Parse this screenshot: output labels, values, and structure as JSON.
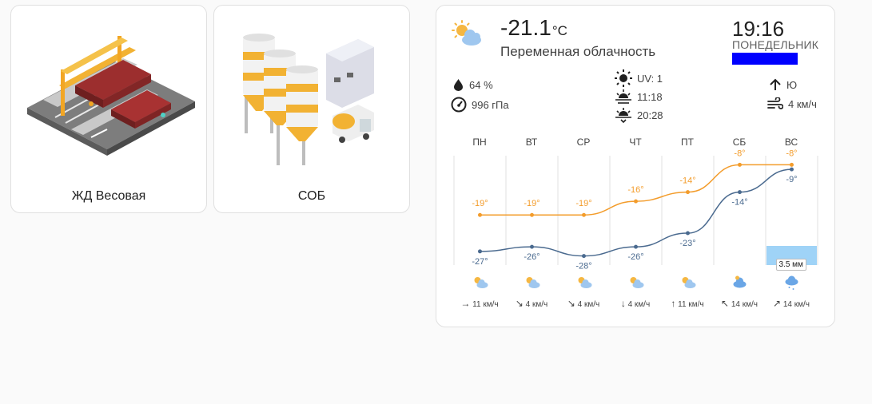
{
  "tiles": [
    {
      "label": "ЖД Весовая",
      "icon": "railway-scale-icon"
    },
    {
      "label": "СОБ",
      "icon": "concrete-plant-icon"
    }
  ],
  "weather": {
    "temperature": "-21.1",
    "unit": "°C",
    "condition": "Переменная облачность",
    "time": "19:16",
    "weekday": "ПОНЕДЕЛЬНИК",
    "humidity": "64 %",
    "pressure": "996 гПа",
    "uv": "UV: 1",
    "sunrise": "11:18",
    "sunset": "20:28",
    "wind_direction": "Ю",
    "wind_speed": "4 км/ч"
  },
  "forecast": {
    "days": [
      "ПН",
      "ВТ",
      "СР",
      "ЧТ",
      "ПТ",
      "СБ",
      "ВС"
    ],
    "wind": [
      {
        "arrow": "→",
        "speed": "11 км/ч"
      },
      {
        "arrow": "↘",
        "speed": "4 км/ч"
      },
      {
        "arrow": "↘",
        "speed": "4 км/ч"
      },
      {
        "arrow": "↓",
        "speed": "4 км/ч"
      },
      {
        "arrow": "↑",
        "speed": "11 км/ч"
      },
      {
        "arrow": "↖",
        "speed": "14 км/ч"
      },
      {
        "arrow": "↗",
        "speed": "14 км/ч"
      }
    ],
    "icons": [
      "partly-cloudy-icon",
      "partly-cloudy-icon",
      "partly-cloudy-icon",
      "partly-cloudy-icon",
      "partly-cloudy-icon",
      "cloudy-snow-icon",
      "snow-icon"
    ]
  },
  "chart_data": {
    "type": "line",
    "categories": [
      "ПН",
      "ВТ",
      "СР",
      "ЧТ",
      "ПТ",
      "СБ",
      "ВС"
    ],
    "series": [
      {
        "values": [
          -19,
          -19,
          -19,
          -16,
          -14,
          -8,
          -8
        ],
        "labels": [
          "-19°",
          "-19°",
          "-19°",
          "-16°",
          "-14°",
          "-8°",
          "-8°"
        ],
        "color": "#f39c2b"
      },
      {
        "values": [
          -27,
          -26,
          -28,
          -26,
          -23,
          -14,
          -9
        ],
        "labels": [
          "-27°",
          "-26°",
          "-28°",
          "-26°",
          "-23°",
          "-14°",
          "-9°"
        ],
        "color": "#4a6a8f"
      }
    ],
    "precipitation": {
      "values": [
        0,
        0,
        0,
        0,
        0,
        0,
        3.5
      ],
      "labels": [
        "",
        "",
        "",
        "",
        "",
        "",
        "3.5 мм"
      ],
      "color": "#9fd3f7"
    },
    "ylim": [
      -30,
      -6
    ],
    "grid": "vertical"
  }
}
